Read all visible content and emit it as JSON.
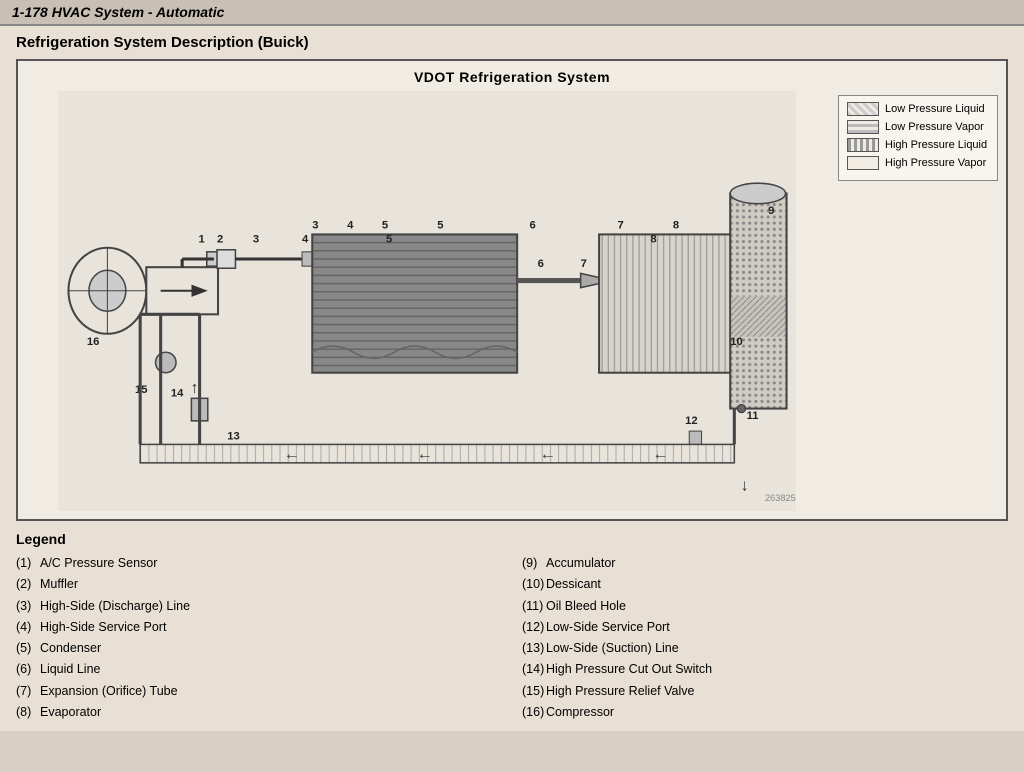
{
  "header": {
    "text": "1-178  HVAC System - Automatic"
  },
  "section_title": "Refrigeration System Description (Buick)",
  "diagram_title": "VDOT Refrigeration System",
  "legend_key": {
    "items": [
      {
        "label": "Low Pressure Liquid",
        "swatch": "lp-liquid"
      },
      {
        "label": "Low Pressure Vapor",
        "swatch": "lp-vapor"
      },
      {
        "label": "High Pressure Liquid",
        "swatch": "hp-liquid"
      },
      {
        "label": "High Pressure Vapor",
        "swatch": "hp-vapor"
      }
    ]
  },
  "diagram_ref": "263825",
  "legend_title": "Legend",
  "legend_left": [
    {
      "num": "(1)",
      "text": "A/C Pressure Sensor"
    },
    {
      "num": "(2)",
      "text": "Muffler"
    },
    {
      "num": "(3)",
      "text": "High-Side (Discharge) Line"
    },
    {
      "num": "(4)",
      "text": "High-Side Service Port"
    },
    {
      "num": "(5)",
      "text": "Condenser"
    },
    {
      "num": "(6)",
      "text": "Liquid Line"
    },
    {
      "num": "(7)",
      "text": "Expansion (Orifice) Tube"
    },
    {
      "num": "(8)",
      "text": "Evaporator"
    }
  ],
  "legend_right": [
    {
      "num": "(9)",
      "text": "Accumulator"
    },
    {
      "num": "(10)",
      "text": "Dessicant"
    },
    {
      "num": "(11)",
      "text": "Oil Bleed Hole"
    },
    {
      "num": "(12)",
      "text": "Low-Side Service Port"
    },
    {
      "num": "(13)",
      "text": "Low-Side (Suction) Line"
    },
    {
      "num": "(14)",
      "text": "High Pressure Cut Out Switch"
    },
    {
      "num": "(15)",
      "text": "High Pressure Relief Valve"
    },
    {
      "num": "(16)",
      "text": "Compressor"
    }
  ]
}
